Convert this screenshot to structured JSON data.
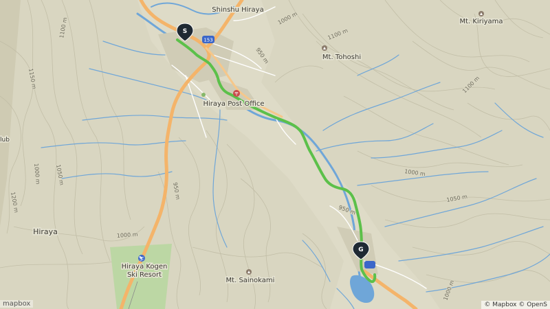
{
  "map": {
    "places": {
      "shinshu_hiraya": "Shinshu Hiraya",
      "hiraya_post_office": "Hiraya Post Office",
      "mt_kiriyama": "Mt. Kiriyama",
      "mt_tohoshi": "Mt. Tohoshi",
      "mt_sainokami": "Mt. Sainokami",
      "hiraya": "Hiraya",
      "ski_resort_line1": "Hiraya Kogen",
      "ski_resort_line2": "Ski Resort",
      "club_fragment": "lub"
    },
    "road_shields": {
      "route_153": "153"
    },
    "markers": {
      "start": "S",
      "goal": "G"
    },
    "contour_labels": [
      "1000 m",
      "1100 m",
      "950 m",
      "1150 m",
      "1100 m",
      "1000 m",
      "1100 m",
      "1050 m",
      "1200 m",
      "950 m",
      "1000 m",
      "950 m",
      "1000 m",
      "1050 m",
      "1000 m"
    ],
    "attribution": "© Mapbox © OpenS",
    "logo": "mapbox",
    "colors": {
      "route": "#5cc04a",
      "highway": "#f4b46a",
      "water": "#6fa6d8",
      "terrain": "#d9d6c1",
      "marker": "#1f2933"
    }
  }
}
